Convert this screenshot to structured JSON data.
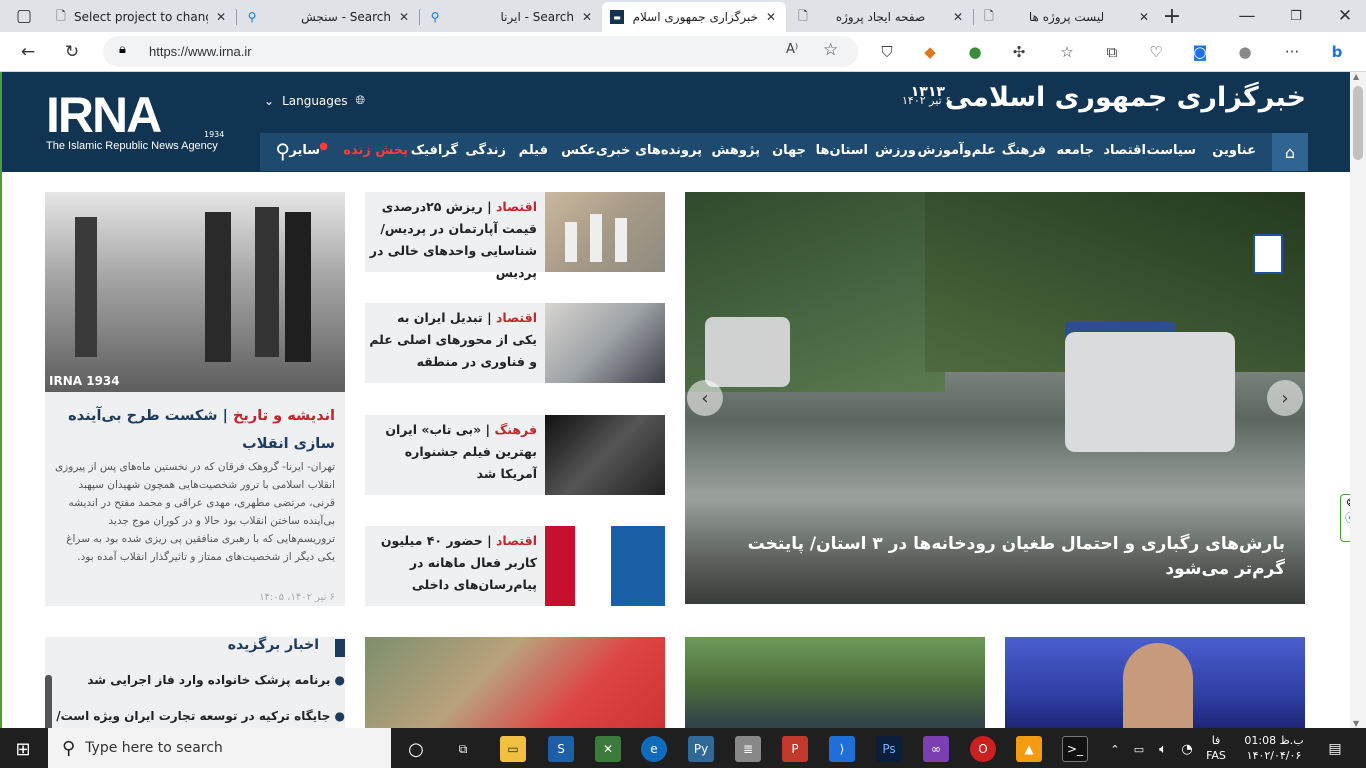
{
  "tabs": [
    {
      "title": "Select project to chang",
      "icon": "document-icon"
    },
    {
      "title": "سنجش - Search",
      "icon": "search-icon"
    },
    {
      "title": "ایرنا - Search",
      "icon": "search-icon"
    },
    {
      "title": "خبرگزاری جمهوری اسلام",
      "icon": "irna-icon",
      "active": true
    },
    {
      "title": "صفحه ایجاد پروژه",
      "icon": "document-icon"
    },
    {
      "title": "لیست پروژه ها",
      "icon": "document-icon"
    }
  ],
  "address": {
    "url": "https://www.irna.ir"
  },
  "site": {
    "logo": "IRNA",
    "logo_sub": "The Islamic Republic News Agency",
    "logo_year": "1934",
    "languages": "Languages",
    "title": "خبرگزاری جمهوری اسلامی",
    "title_year": "۱۳۱۳",
    "date": "۶ تیر ۱۴۰۲"
  },
  "nav": [
    "عناوین",
    "سیاست",
    "اقتصاد",
    "جامعه",
    "فرهنگ",
    "علم‌وآموزش",
    "ورزش",
    "استان‌ها",
    "جهان",
    "پژوهش",
    "پرونده‌های خبری",
    "عکس",
    "فیلم",
    "زندگی",
    "گرافیک",
    "پخش زنده",
    "سایر"
  ],
  "hero": {
    "headline": "بارش‌های رگباری و احتمال طغیان رودخانه‌ها در ۳ استان/ پایتخت گرم‌تر می‌شود"
  },
  "small_news": [
    {
      "cat": "اقتصاد",
      "text": "ریزش ۲۵درصدی قیمت آپارتمان در پردیس/ شناسایی واحدهای خالی در پردیس"
    },
    {
      "cat": "اقتصاد",
      "text": "تبدیل ایران به یکی از محورهای اصلی علم و فناوری در منطقه"
    },
    {
      "cat": "فرهنگ",
      "text": "«بی تاب» ایران بهترین فیلم جشنواره آمریکا شد"
    },
    {
      "cat": "اقتصاد",
      "text": "حضور ۴۰ میلیون کاربر فعال ماهانه در پیام‌رسان‌های داخلی"
    }
  ],
  "feature": {
    "cat": "اندیشه و تاریخ",
    "title": "شکست طرح بی‌آینده سازی انقلاب",
    "body": "تهران- ایرنا- گروهک فرقان که در نخستین ماه‌های پس از پیروزی انقلاب اسلامی با ترور شخصیت‌هایی همچون شهیدان سپهبد قرنی، مرتضی مطهری، مهدی عراقی و محمد مفتح در اندیشه بی‌آینده ساختن انقلاب بود حالا و در کوران موج جدید تروریسم‌هایی که با رهبری منافقین پی ریزی شده بود به سراغ یکی دیگر از شخصیت‌های ممتاز و تاثیرگذار انقلاب آمده بود.",
    "date": "۶ تیر ۱۴۰۲، ۱۴:۰۵",
    "photo_mark": "IRNA 1934"
  },
  "picked": {
    "title": "اخبار برگزیده",
    "items": [
      "برنامه پزشک خانواده وارد فاز اجرایی شد",
      "جایگاه ترکیه در توسعه تجارت ایران ویژه است/"
    ]
  },
  "taskbar": {
    "search_placeholder": "Type here to search",
    "time": "ب.ظ 01:08",
    "date": "۱۴۰۲/۰۴/۰۶",
    "lang_top": "فا",
    "lang_bottom": "FAS"
  },
  "colors": {
    "header": "#113452",
    "nav": "#1d4a6e",
    "category": "#c0272d",
    "live": "#ff3b3b"
  }
}
